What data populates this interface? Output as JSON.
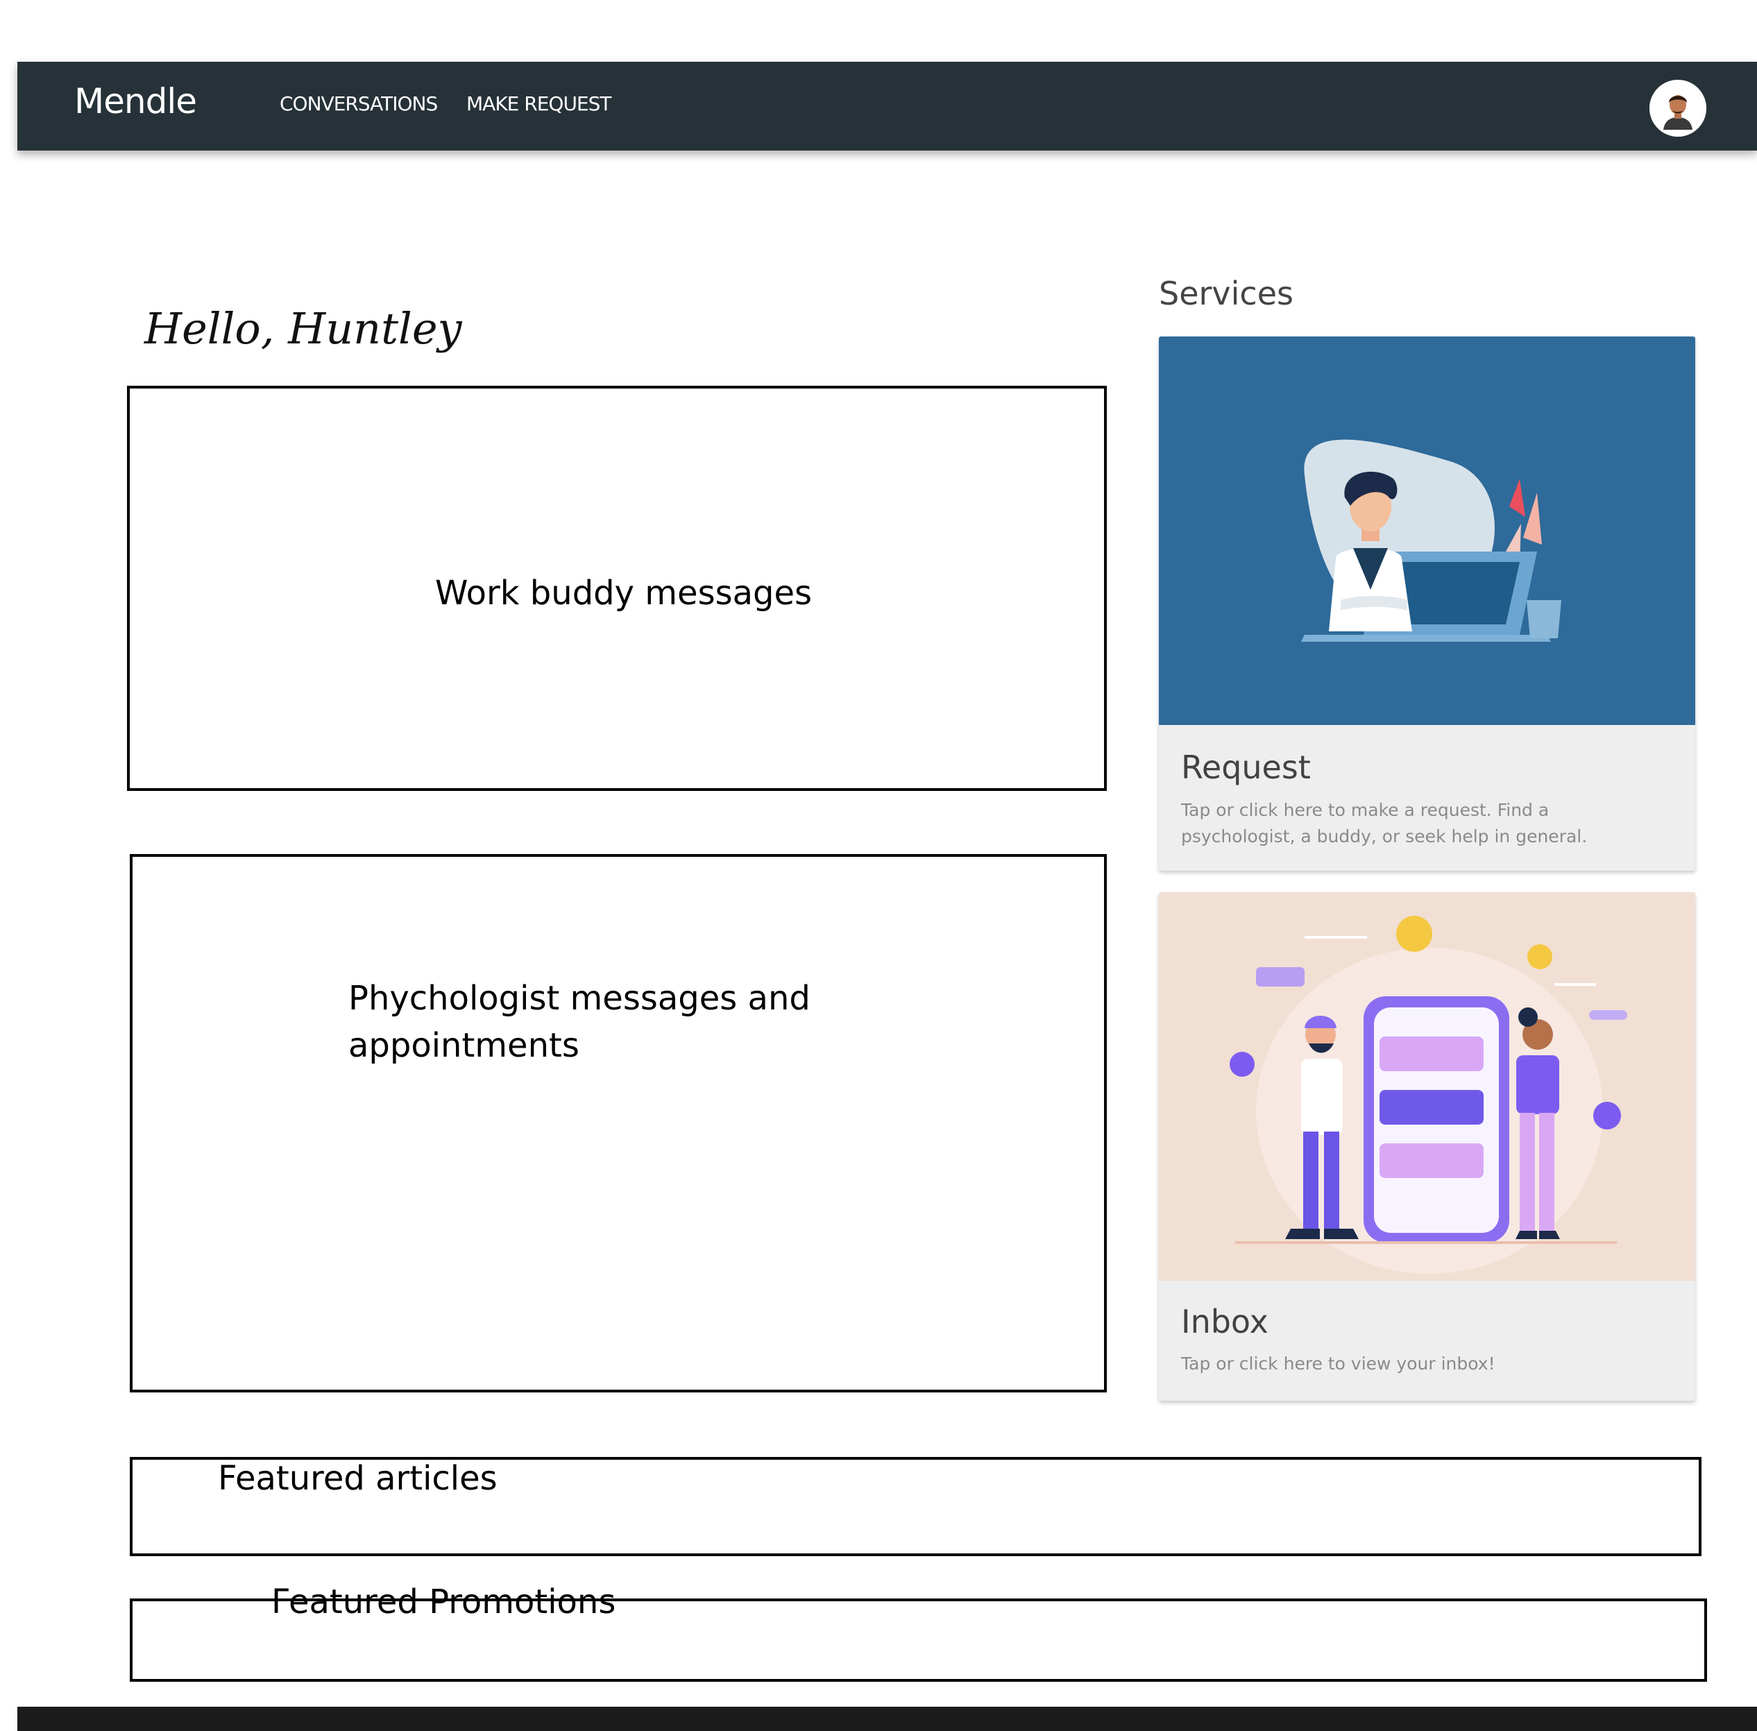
{
  "navbar": {
    "brand": "Mendle",
    "links": [
      {
        "label": "CONVERSATIONS"
      },
      {
        "label": "MAKE REQUEST"
      }
    ],
    "background_color": "#263238"
  },
  "greeting": "Hello, Huntley",
  "wireframe_boxes": {
    "work_buddy": "Work buddy messages",
    "psychologist_line1": "Phychologist messages and",
    "psychologist_line2": "appointments",
    "articles": "Featured articles",
    "promotions": "Featured Promotions"
  },
  "services": {
    "title": "Services",
    "cards": [
      {
        "title": "Request",
        "description": "Tap or click here to make a request. Find a psychologist, a buddy, or seek help in general.",
        "image_color": "#2e6a9a",
        "icon": "doctor-laptop-illustration"
      },
      {
        "title": "Inbox",
        "description": "Tap or click here to view your inbox!",
        "image_color": "#f2dfd3",
        "icon": "chat-phone-illustration"
      }
    ]
  }
}
